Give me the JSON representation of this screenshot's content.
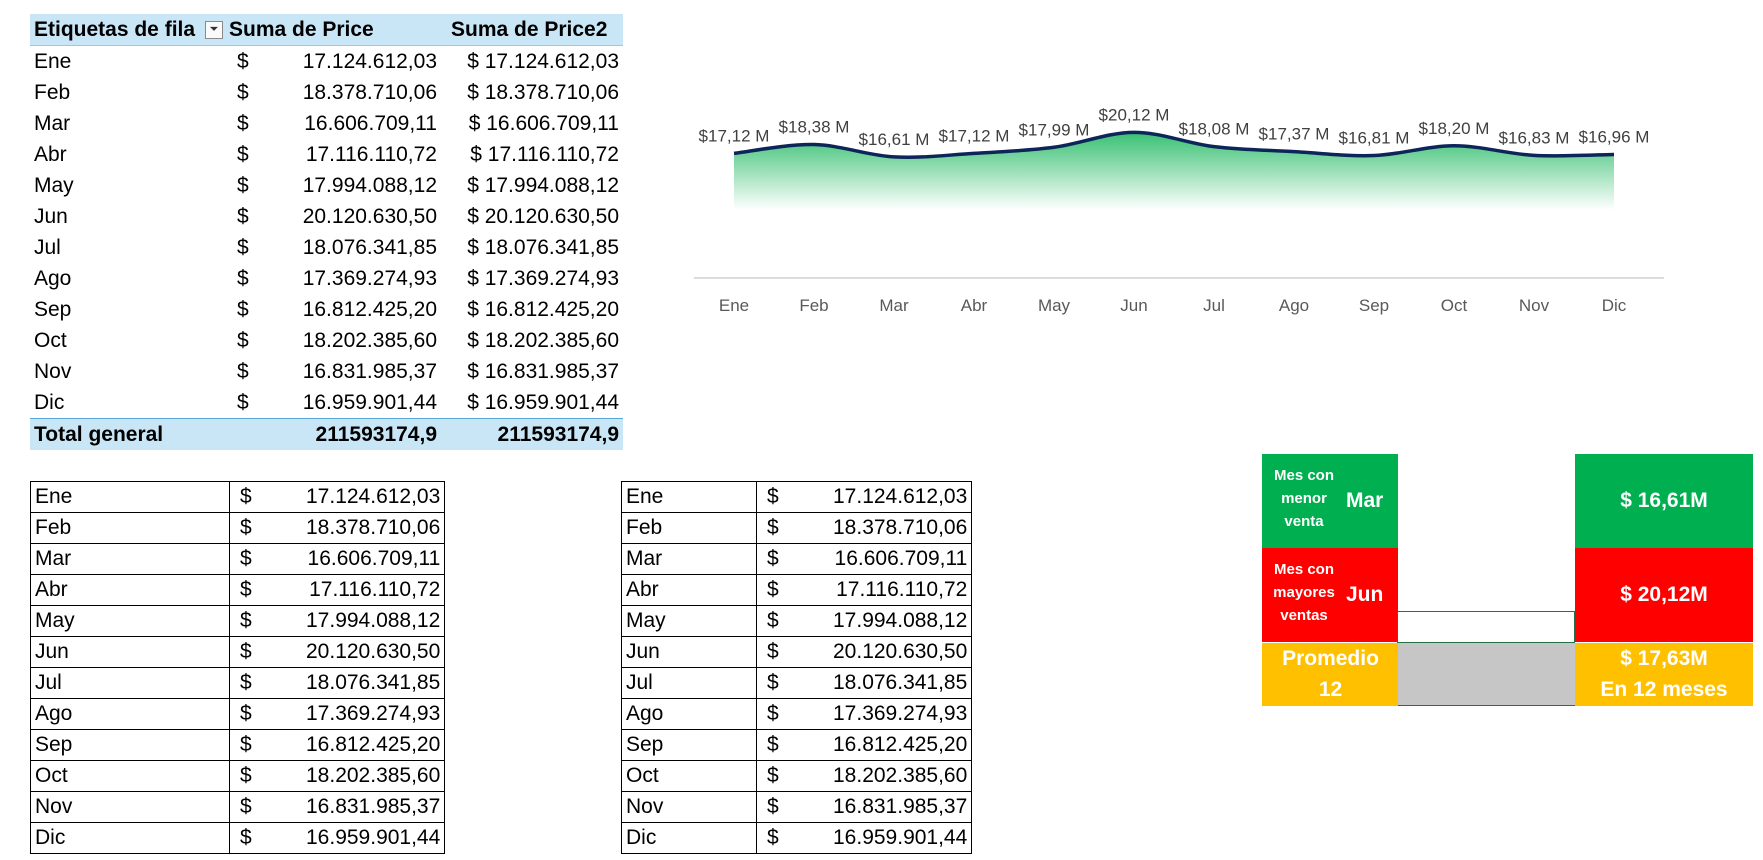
{
  "pivot": {
    "headers": [
      "Etiquetas de fila",
      "Suma de Price",
      "Suma de Price2"
    ],
    "filter_icon": "filter-sort-icon",
    "currency": "$",
    "rows": [
      {
        "month": "Ene",
        "price": "17.124.612,03",
        "price2": "$ 17.124.612,03"
      },
      {
        "month": "Feb",
        "price": "18.378.710,06",
        "price2": "$ 18.378.710,06"
      },
      {
        "month": "Mar",
        "price": "16.606.709,11",
        "price2": "$ 16.606.709,11"
      },
      {
        "month": "Abr",
        "price": "17.116.110,72",
        "price2": "$ 17.116.110,72"
      },
      {
        "month": "May",
        "price": "17.994.088,12",
        "price2": "$ 17.994.088,12"
      },
      {
        "month": "Jun",
        "price": "20.120.630,50",
        "price2": "$ 20.120.630,50"
      },
      {
        "month": "Jul",
        "price": "18.076.341,85",
        "price2": "$ 18.076.341,85"
      },
      {
        "month": "Ago",
        "price": "17.369.274,93",
        "price2": "$ 17.369.274,93"
      },
      {
        "month": "Sep",
        "price": "16.812.425,20",
        "price2": "$ 16.812.425,20"
      },
      {
        "month": "Oct",
        "price": "18.202.385,60",
        "price2": "$ 18.202.385,60"
      },
      {
        "month": "Nov",
        "price": "16.831.985,37",
        "price2": "$ 16.831.985,37"
      },
      {
        "month": "Dic",
        "price": "16.959.901,44",
        "price2": "$ 16.959.901,44"
      }
    ],
    "total": {
      "label": "Total general",
      "price": "211593174,9",
      "price2": "211593174,9"
    }
  },
  "table_rows": [
    {
      "month": "Ene",
      "value": "17.124.612,03"
    },
    {
      "month": "Feb",
      "value": "18.378.710,06"
    },
    {
      "month": "Mar",
      "value": "16.606.709,11"
    },
    {
      "month": "Abr",
      "value": "17.116.110,72"
    },
    {
      "month": "May",
      "value": "17.994.088,12"
    },
    {
      "month": "Jun",
      "value": "20.120.630,50"
    },
    {
      "month": "Jul",
      "value": "18.076.341,85"
    },
    {
      "month": "Ago",
      "value": "17.369.274,93"
    },
    {
      "month": "Sep",
      "value": "16.812.425,20"
    },
    {
      "month": "Oct",
      "value": "18.202.385,60"
    },
    {
      "month": "Nov",
      "value": "16.831.985,37"
    },
    {
      "month": "Dic",
      "value": "16.959.901,44"
    }
  ],
  "kpi": {
    "low_label": "Mes con menor venta",
    "low_month": "Mar",
    "low_value": "$ 16,61M",
    "high_label": "Mes con mayores ventas",
    "high_month": "Jun",
    "high_value": "$ 20,12M",
    "avg_label": "Promedio",
    "avg_count": "12",
    "avg_value": "$ 17,63M",
    "avg_sub": "En 12 meses"
  },
  "colors": {
    "line": "#0d2559",
    "area": "#2ebd6b",
    "green": "#00b050",
    "red": "#ff0000",
    "yellow": "#ffc000",
    "grey": "#c6c6c6",
    "pivot_header": "#c8e6f5"
  },
  "chart_data": {
    "type": "area",
    "categories": [
      "Ene",
      "Feb",
      "Mar",
      "Abr",
      "May",
      "Jun",
      "Jul",
      "Ago",
      "Sep",
      "Oct",
      "Nov",
      "Dic"
    ],
    "values": [
      17.12,
      18.38,
      16.61,
      17.12,
      17.99,
      20.12,
      18.08,
      17.37,
      16.81,
      18.2,
      16.83,
      16.96
    ],
    "data_labels": [
      "$17,12 M",
      "$18,38 M",
      "$16,61 M",
      "$17,12 M",
      "$17,99 M",
      "$20,12 M",
      "$18,08 M",
      "$17,37 M",
      "$16,81 M",
      "$18,20 M",
      "$16,83 M",
      "$16,96 M"
    ],
    "title": "",
    "xlabel": "",
    "ylabel": "",
    "smooth": true,
    "grid": false,
    "legend": "none"
  }
}
